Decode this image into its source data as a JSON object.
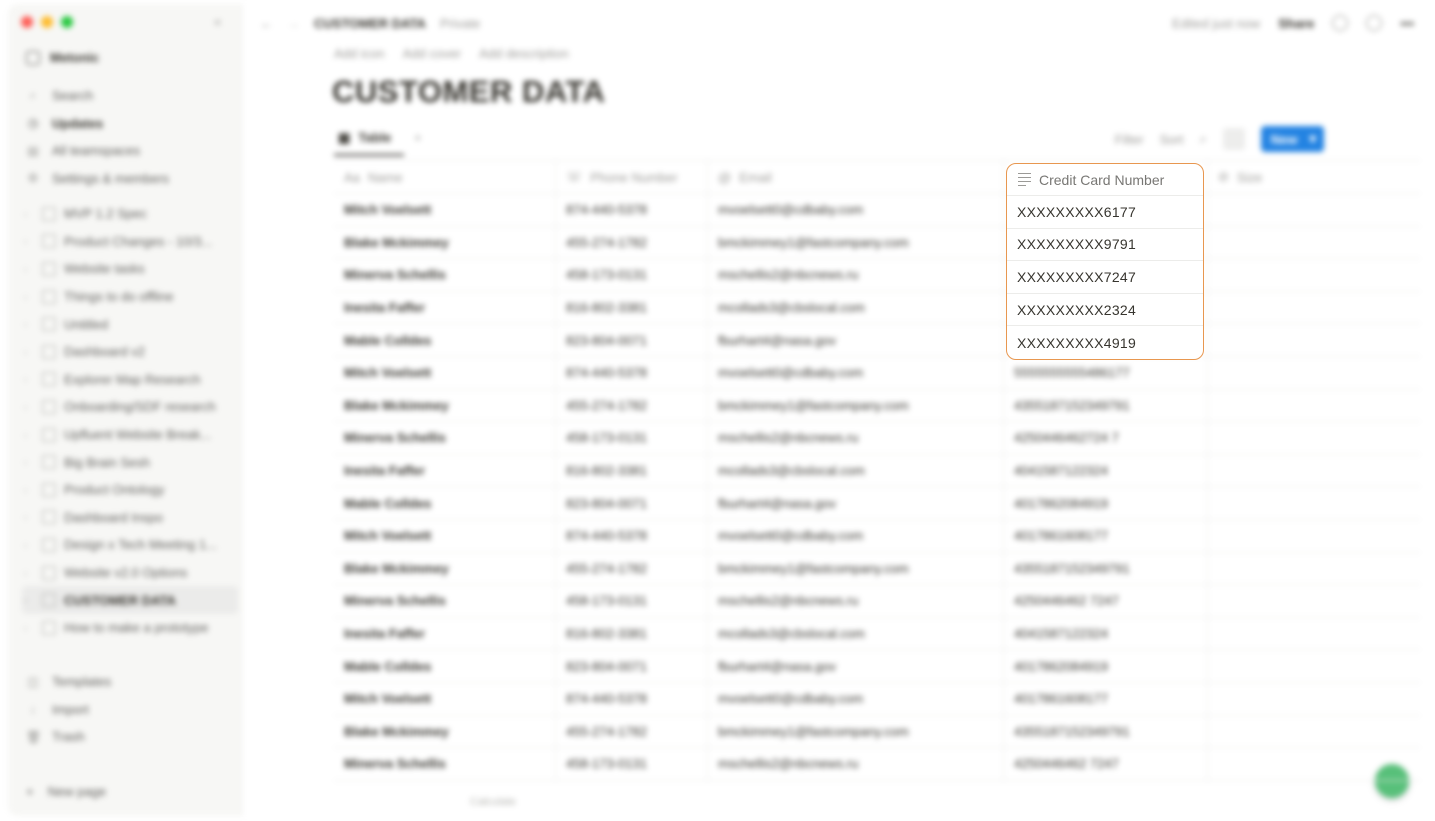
{
  "window": {
    "traffic_lights": [
      "close",
      "minimize",
      "zoom"
    ]
  },
  "sidebar": {
    "workspace": "Metonic",
    "nav": [
      {
        "icon": "search-icon",
        "label": "Search"
      },
      {
        "icon": "clock-icon",
        "label": "Updates"
      },
      {
        "icon": "grid-icon",
        "label": "All teamspaces"
      },
      {
        "icon": "gear-icon",
        "label": "Settings & members"
      }
    ],
    "pages": [
      "MVP 1.2 Spec",
      "Product Changes - 10/3...",
      "Website tasks",
      "Things to do offline",
      "Untitled",
      "Dashboard v2",
      "Explorer Map Research",
      "Onboarding/SDF research",
      "Upfluent Website Break...",
      "Big Brain Sesh",
      "Product Ontology",
      "Dashboard Inspo",
      "Design x Tech Meeting 1...",
      "Website v2.0 Options",
      "CUSTOMER DATA",
      "How to make a prototype"
    ],
    "active_page": "CUSTOMER DATA",
    "bottom": [
      {
        "icon": "template-icon",
        "label": "Templates"
      },
      {
        "icon": "import-icon",
        "label": "Import"
      },
      {
        "icon": "trash-icon",
        "label": "Trash"
      }
    ],
    "new_page": "New page"
  },
  "topbar": {
    "breadcrumb": "CUSTOMER DATA",
    "privacy": "Private",
    "edited": "Edited just now",
    "share": "Share"
  },
  "page": {
    "actions": [
      "Add icon",
      "Add cover",
      "Add description"
    ],
    "title": "CUSTOMER DATA"
  },
  "view": {
    "tab": "Table",
    "filter": "Filter",
    "sort": "Sort",
    "new_button": "New"
  },
  "table": {
    "columns": [
      "Name",
      "Phone Number",
      "Email",
      "Credit Card Number",
      "Size"
    ],
    "rows": [
      [
        "Mitch Voelsett",
        "874-440-5378",
        "mvoelsett0@cdbaby.com",
        "XXXXXXXXX6177",
        ""
      ],
      [
        "Blake Mckimmey",
        "455-274-1782",
        "bmckimmey1@fastcompany.com",
        "XXXXXXXXX9791",
        ""
      ],
      [
        "Minerva Schellis",
        "458-173-0131",
        "mschellis2@nbcnews.ru",
        "XXXXXXXXX7247",
        ""
      ],
      [
        "Inesita Faffer",
        "816-802-3381",
        "mcollads3@cbslocal.com",
        "XXXXXXXXX2324",
        ""
      ],
      [
        "Mable Colldes",
        "823-804-0071",
        "fburhart4@nasa.gov",
        "XXXXXXXXX4919",
        ""
      ],
      [
        "Mitch Voelsett",
        "874-440-5378",
        "mvoelsett0@cdbaby.com",
        "5555555555486177",
        ""
      ],
      [
        "Blake Mckimmey",
        "455-274-1782",
        "bmckimmey1@fastcompany.com",
        "4355187152349791",
        ""
      ],
      [
        "Minerva Schellis",
        "458-173-0131",
        "mschellis2@nbcnews.ru",
        "4250446462724 7",
        ""
      ],
      [
        "Inesita Faffer",
        "816-802-3381",
        "mcollads3@cbslocal.com",
        "4041587122324",
        ""
      ],
      [
        "Mable Colldes",
        "823-804-0071",
        "fburhart4@nasa.gov",
        "4017862084919",
        ""
      ],
      [
        "Mitch Voelsett",
        "874-440-5378",
        "mvoelsett0@cdbaby.com",
        "4017861608177",
        ""
      ],
      [
        "Blake Mckimmey",
        "455-274-1782",
        "bmckimmey1@fastcompany.com",
        "4355187152349791",
        ""
      ],
      [
        "Minerva Schellis",
        "458-173-0131",
        "mschellis2@nbcnews.ru",
        "4250446462 7247",
        ""
      ],
      [
        "Inesita Faffer",
        "816-802-3381",
        "mcollads3@cbslocal.com",
        "4041587122324",
        ""
      ],
      [
        "Mable Colldes",
        "823-804-0071",
        "fburhart4@nasa.gov",
        "4017862084919",
        ""
      ],
      [
        "Mitch Voelsett",
        "874-440-5378",
        "mvoelsett0@cdbaby.com",
        "4017861608177",
        ""
      ],
      [
        "Blake Mckimmey",
        "455-274-1782",
        "bmckimmey1@fastcompany.com",
        "4355187152349791",
        ""
      ],
      [
        "Minerva Schellis",
        "458-173-0131",
        "mschellis2@nbcnews.ru",
        "4250446462 7247",
        ""
      ]
    ],
    "footer": "Calculate"
  },
  "highlight": {
    "header": "Credit Card Number",
    "values": [
      "XXXXXXXXX6177",
      "XXXXXXXXX9791",
      "XXXXXXXXX7247",
      "XXXXXXXXX2324",
      "XXXXXXXXX4919"
    ],
    "border_color": "#e8974f"
  },
  "colors": {
    "accent": "#2383e2",
    "highlight_border": "#e8974f"
  }
}
